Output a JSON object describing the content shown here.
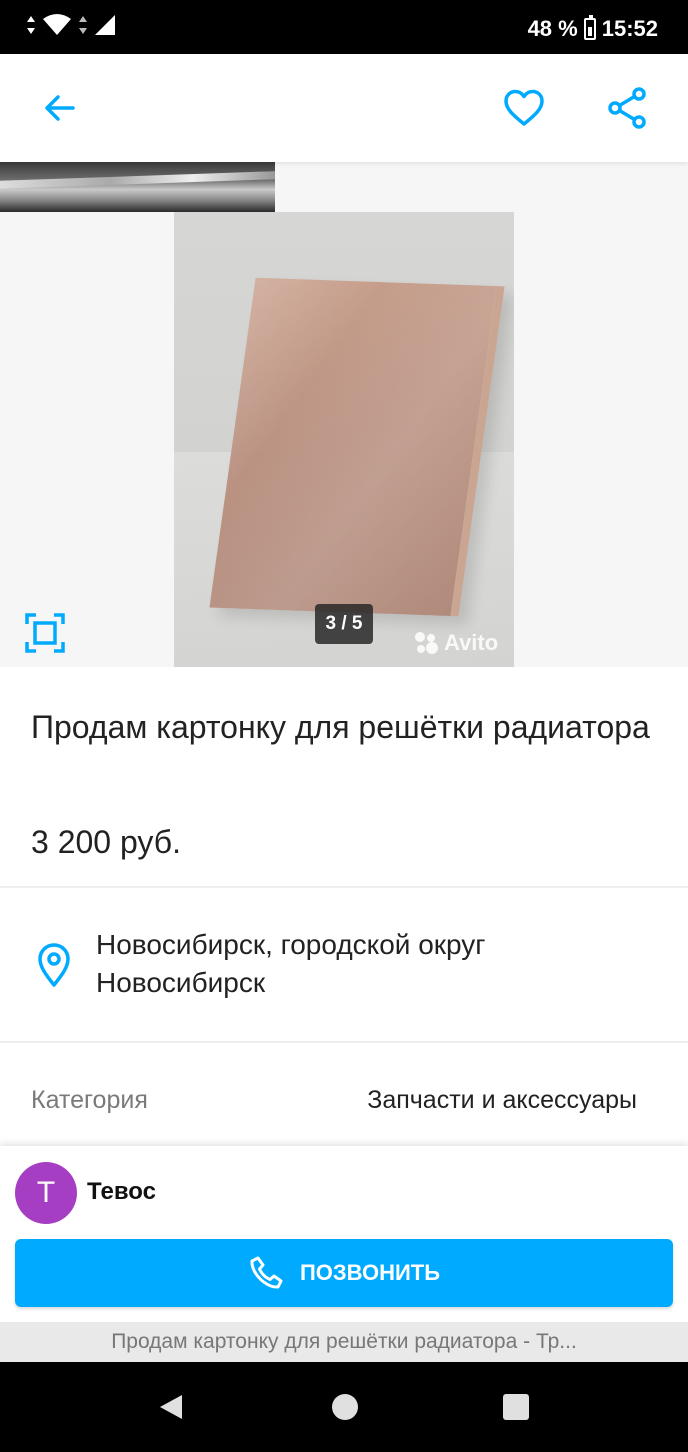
{
  "status_bar": {
    "battery": "48 %",
    "time": "15:52"
  },
  "app_bar": {
    "back_icon": "arrow-left-icon",
    "favorite_icon": "heart-outline-icon",
    "share_icon": "share-icon"
  },
  "gallery": {
    "counter": "3 / 5",
    "watermark": "Avito",
    "fullscreen_icon": "fullscreen-icon"
  },
  "listing": {
    "title": "Продам картонку для решётки радиатора",
    "price": "3 200 руб.",
    "location": "Новосибирск, городской округ Новосибирск",
    "category_label": "Категория",
    "category_value": "Запчасти и аксессуары"
  },
  "seller": {
    "initial": "Т",
    "name": "Тевос"
  },
  "call_button": {
    "label": "ПОЗВОНИТЬ"
  },
  "caption": "Продам картонку для решётки радиатора - Тр...",
  "colors": {
    "accent": "#00aaff",
    "avatar": "#a53ec2"
  }
}
